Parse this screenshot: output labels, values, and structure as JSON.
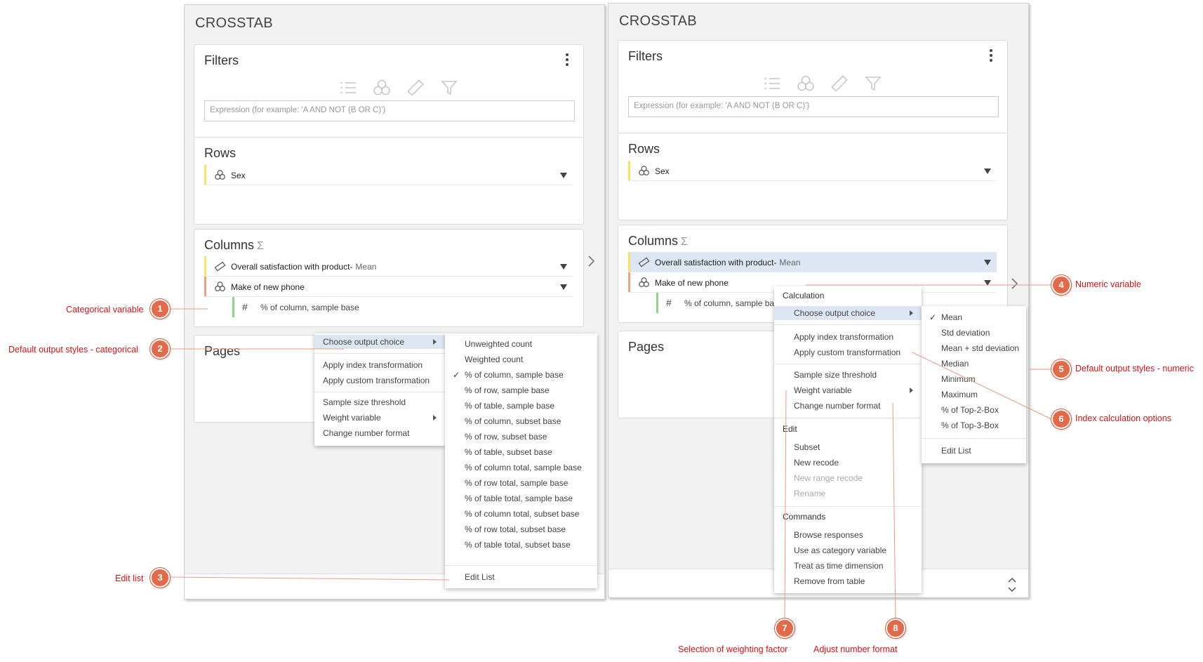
{
  "left": {
    "title": "CROSSTAB",
    "filters": {
      "title": "Filters",
      "expression_placeholder": "Expression (for example: 'A AND NOT (B OR C)')"
    },
    "rows": {
      "title": "Rows",
      "items": [
        {
          "label": "Sex"
        }
      ]
    },
    "columns": {
      "title": "Columns",
      "sigma": "Σ",
      "items": [
        {
          "label": "Overall satisfaction with product-",
          "suffix": "Mean"
        },
        {
          "label": "Make of new phone",
          "suffix": ""
        }
      ],
      "sub_item": {
        "label": "% of column, sample base"
      }
    },
    "pages": {
      "title": "Pages"
    }
  },
  "right": {
    "title": "CROSSTAB",
    "filters": {
      "title": "Filters",
      "expression_placeholder": "Expression (for example: 'A AND NOT (B OR C)')"
    },
    "rows": {
      "title": "Rows",
      "items": [
        {
          "label": "Sex"
        }
      ]
    },
    "columns": {
      "title": "Columns",
      "sigma": "Σ",
      "items": [
        {
          "label": "Overall satisfaction with product-",
          "suffix": "Mean"
        },
        {
          "label": "Make of new phone",
          "suffix": ""
        }
      ],
      "sub_item": {
        "label": "% of column, sample base"
      }
    },
    "pages": {
      "title": "Pages"
    }
  },
  "left_menu": {
    "choose_output": "Choose output choice",
    "apply_index": "Apply index transformation",
    "apply_custom": "Apply custom transformation",
    "sample_size": "Sample size threshold",
    "weight_variable": "Weight variable",
    "change_format": "Change number format"
  },
  "left_submenu": {
    "items": [
      "Unweighted count",
      "Weighted count",
      "% of column, sample base",
      "% of row, sample base",
      "% of table, sample base",
      "% of column, subset base",
      "% of row, subset base",
      "% of table, subset base",
      "% of column total, sample base",
      "% of row total, sample base",
      "% of table total, sample base",
      "% of column total, subset base",
      "% of row total, subset base",
      "% of table total, subset base"
    ],
    "checked": "% of column, sample base",
    "edit_list": "Edit List"
  },
  "right_menu": {
    "calc_header": "Calculation",
    "choose_output": "Choose output choice",
    "apply_index": "Apply index transformation",
    "apply_custom": "Apply custom transformation",
    "sample_size": "Sample size threshold",
    "weight_variable": "Weight variable",
    "change_format": "Change number format",
    "edit_header": "Edit",
    "subset": "Subset",
    "new_recode": "New recode",
    "new_range_recode": "New range recode",
    "rename": "Rename",
    "commands_header": "Commands",
    "browse": "Browse responses",
    "use_category": "Use as category variable",
    "treat_time": "Treat as time dimension",
    "remove": "Remove from table"
  },
  "right_submenu": {
    "items": [
      "Mean",
      "Std deviation",
      "Mean + std deviation",
      "Median",
      "Minimum",
      "Maximum",
      "% of Top-2-Box",
      "% of Top-3-Box"
    ],
    "checked": "Mean",
    "edit_list": "Edit List"
  },
  "annotations": [
    {
      "n": "1",
      "text": "Categorical variable"
    },
    {
      "n": "2",
      "text": "Default output styles - categorical"
    },
    {
      "n": "3",
      "text": "Edit list"
    },
    {
      "n": "4",
      "text": "Numeric variable"
    },
    {
      "n": "5",
      "text": "Default output styles - numeric"
    },
    {
      "n": "6",
      "text": "Index calculation options"
    },
    {
      "n": "7",
      "text": "Selection of weighting factor"
    },
    {
      "n": "8",
      "text": "Adjust number format"
    }
  ],
  "colors": {
    "accent_highlight": "#dde7f4",
    "callout": "#e06a4a",
    "annotation_text": "#c81818",
    "bar_yellow": "#f3e36a",
    "bar_orange": "#f0a08a",
    "bar_green": "#8fd48a"
  }
}
